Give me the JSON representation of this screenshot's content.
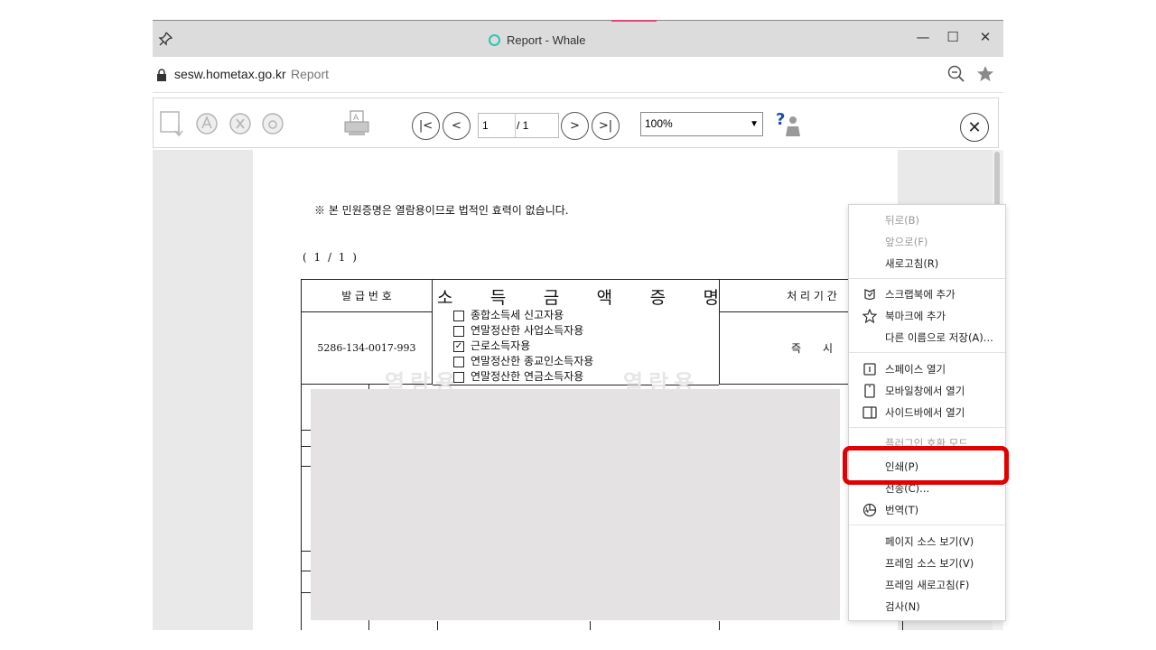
{
  "browser": {
    "title": "Report - Whale",
    "domain": "sesw.hometax.go.kr",
    "path": "Report",
    "controls": {
      "minimize": "—",
      "maximize": "☐",
      "close": "✕"
    }
  },
  "toolbar": {
    "page_current": "1",
    "page_total": "/ 1",
    "zoom_value": "100%",
    "nav": {
      "first": "|<",
      "prev": "<",
      "next": ">",
      "last": ">|"
    },
    "close": "✕"
  },
  "document": {
    "notice": "※ 본 민원증명은 열람용이므로 법적인 효력이 없습니다.",
    "page_info": "( 1 / 1 )",
    "form": {
      "issue_number_label": "발 급 번 호",
      "issue_number": "5286-134-0017-993",
      "title_chars": [
        "소",
        "득",
        "금",
        "액",
        "증",
        "명"
      ],
      "processing_label": "처 리 기 간",
      "processing_value": "즉　　시",
      "options": [
        {
          "label": "종합소득세 신고자용",
          "checked": ""
        },
        {
          "label": "연말정산한 사업소득자용",
          "checked": ""
        },
        {
          "label": "근로소득자용",
          "checked": "✓"
        },
        {
          "label": "연말정산한 종교인소득자용",
          "checked": ""
        },
        {
          "label": "연말정산한 연금소득자용",
          "checked": ""
        }
      ],
      "watermark": "열람용"
    }
  },
  "context_menu": {
    "items": [
      {
        "label": "뒤로(B)",
        "disabled": true
      },
      {
        "label": "앞으로(F)",
        "disabled": true
      },
      {
        "label": "새로고침(R)",
        "disabled": false
      },
      {
        "label": "스크랩북에 추가",
        "disabled": false,
        "icon": "scrapbook-icon"
      },
      {
        "label": "북마크에 추가",
        "disabled": false,
        "icon": "star-icon"
      },
      {
        "label": "다른 이름으로 저장(A)...",
        "disabled": false
      },
      {
        "label": "스페이스 열기",
        "disabled": false,
        "icon": "space-icon"
      },
      {
        "label": "모바일창에서 열기",
        "disabled": false,
        "icon": "mobile-icon"
      },
      {
        "label": "사이드바에서 열기",
        "disabled": false,
        "icon": "sidebar-icon"
      },
      {
        "label": "플러그인 호환 모드",
        "disabled": true
      },
      {
        "label": "인쇄(P)",
        "disabled": false
      },
      {
        "label": "전송(C)...",
        "disabled": false
      },
      {
        "label": "번역(T)",
        "disabled": false,
        "icon": "translate-icon"
      },
      {
        "label": "페이지 소스 보기(V)",
        "disabled": false
      },
      {
        "label": "프레임 소스 보기(V)",
        "disabled": false
      },
      {
        "label": "프레임 새로고침(F)",
        "disabled": false
      },
      {
        "label": "검사(N)",
        "disabled": false
      }
    ]
  },
  "colors": {
    "highlight": "#e30000",
    "accent": "#2ec4b6"
  }
}
